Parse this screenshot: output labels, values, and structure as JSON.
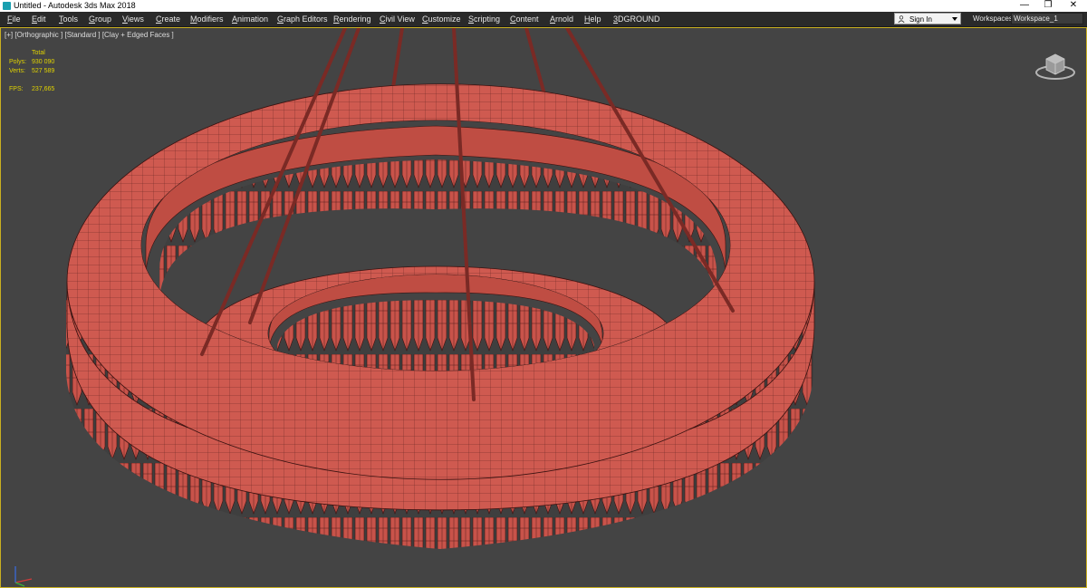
{
  "window": {
    "title": "Untitled - Autodesk 3ds Max 2018",
    "minimize_glyph": "—",
    "maximize_glyph": "❐",
    "close_glyph": "✕"
  },
  "menu": [
    "File",
    "Edit",
    "Tools",
    "Group",
    "Views",
    "Create",
    "Modifiers",
    "Animation",
    "Graph Editors",
    "Rendering",
    "Civil View",
    "Customize",
    "Scripting",
    "Content",
    "Arnold",
    "Help",
    "3DGROUND"
  ],
  "signin": {
    "label": "Sign In",
    "icon": "user-icon"
  },
  "workspaces": {
    "label": "Workspaces:",
    "value": "Workspace_1"
  },
  "viewport": {
    "label": "[+] [Orthographic ] [Standard ] [Clay + Edged Faces ]",
    "stats": {
      "header": "Total",
      "polys_label": "Polys:",
      "polys_value": "930 090",
      "verts_label": "Verts:",
      "verts_value": "527 589",
      "fps_label": "FPS:",
      "fps_value": "237,665"
    }
  },
  "colors": {
    "viewport_bg": "#444444",
    "clay": "#cf5a50",
    "clay_dark": "#a8453c",
    "wire": "#3a1210",
    "stats": "#e0d200",
    "active_border": "#c9b020"
  }
}
